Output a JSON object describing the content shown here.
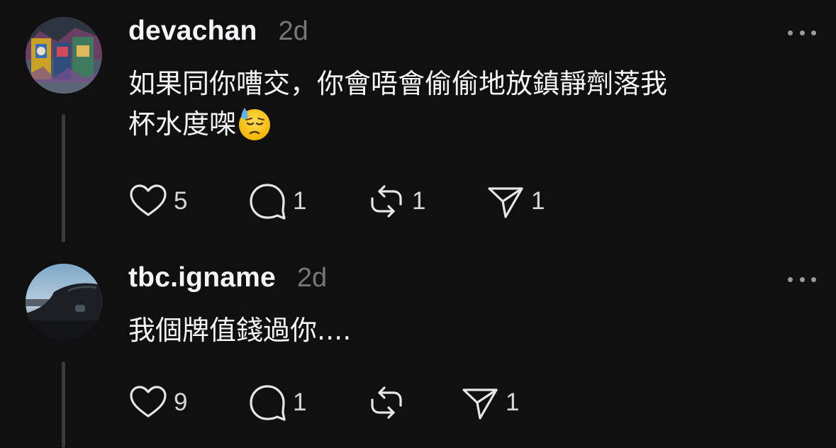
{
  "posts": [
    {
      "username": "devachan",
      "time": "2d",
      "text_line1": "如果同你嘈交，你會唔會偷偷地放鎮靜劑落我",
      "text_line2": "杯水度㗎",
      "emoji": "downcast-face-with-sweat",
      "likes": "5",
      "replies": "1",
      "reposts": "1",
      "shares": "1"
    },
    {
      "username": "tbc.igname",
      "time": "2d",
      "text_line1": "我個牌值錢過你....",
      "likes": "9",
      "replies": "1",
      "reposts": "",
      "shares": "1"
    }
  ],
  "icons": {
    "like": "heart-icon",
    "reply": "speech-bubble-icon",
    "repost": "repost-icon",
    "share": "send-icon",
    "more": "more-horizontal-icon"
  },
  "colors": {
    "background": "#101010",
    "text": "#f3f5f7",
    "muted": "#777777",
    "thread_line": "#3a3a3a"
  }
}
